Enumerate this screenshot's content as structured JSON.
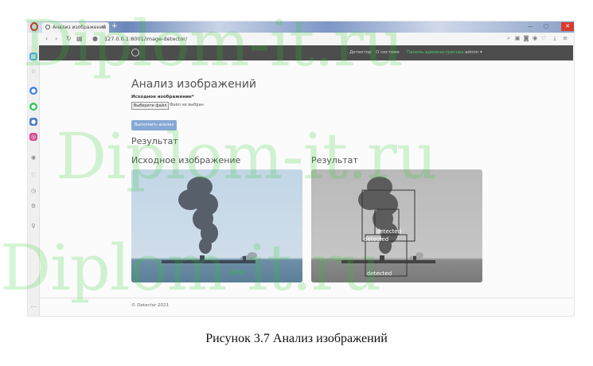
{
  "browser": {
    "tab_title": "Анализ изображений",
    "tab_close": "×",
    "new_tab": "+",
    "url": "127.0.0.1:8001/image-detector/",
    "window_controls": [
      "—",
      "▢",
      "✕"
    ]
  },
  "navbar": {
    "links": [
      "Детектор",
      "О системе",
      "Панель администратора",
      "admin ▾"
    ]
  },
  "page": {
    "title": "Анализ изображений",
    "field_label": "Исходное изображение*",
    "file_button": "Выберите файл",
    "file_status": "Файл не выбран",
    "run_button": "Выполнить анализ",
    "result_heading": "Результат",
    "source_image_title": "Исходное изображение",
    "result_image_title": "Результат",
    "detections": [
      "detected",
      "detected",
      "detected"
    ]
  },
  "footer": {
    "text": "© Detector 2021"
  },
  "watermark": {
    "text": "Diplom-it.ru"
  },
  "caption": {
    "text": "Рисунок 3.7 Анализ изображений"
  }
}
